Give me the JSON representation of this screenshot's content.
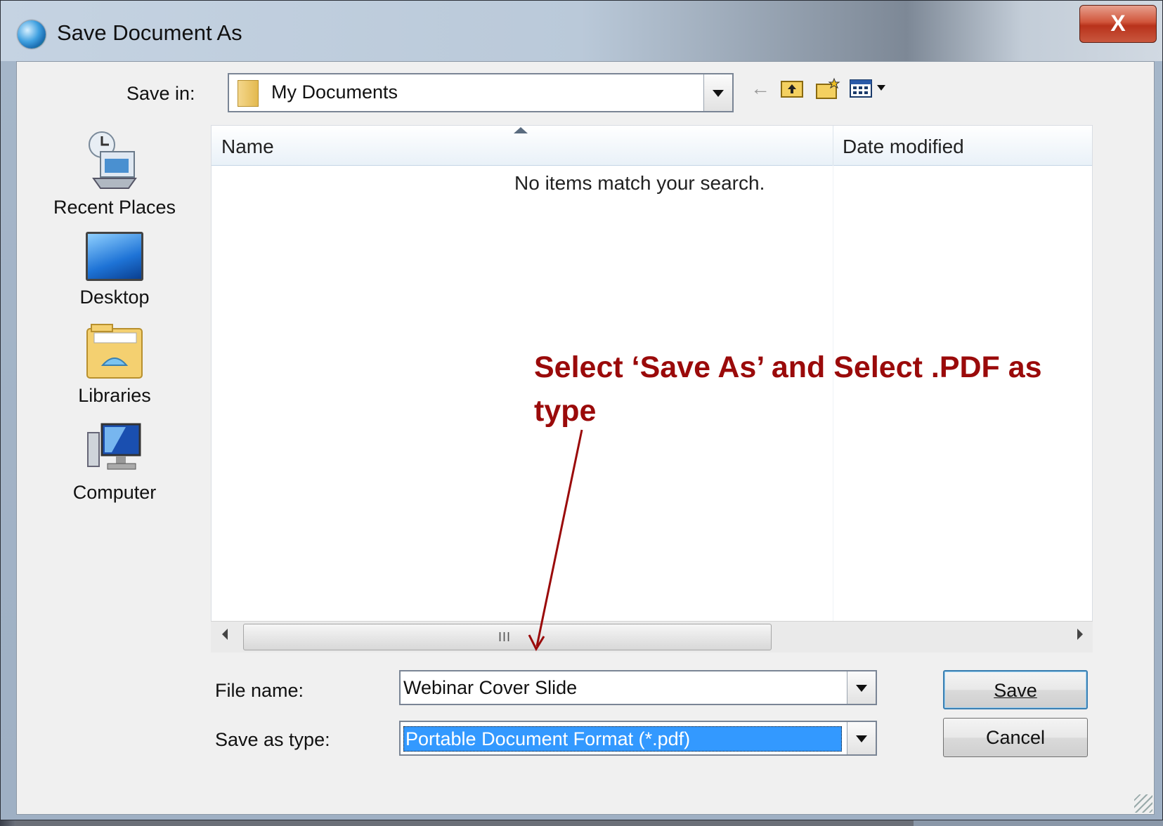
{
  "window": {
    "title": "Save Document As",
    "close_label": "X"
  },
  "save_in": {
    "label": "Save in:",
    "value": "My Documents"
  },
  "toolbar": {
    "back_icon": "back-arrow-icon",
    "up_icon": "up-folder-icon",
    "new_folder_icon": "new-folder-icon",
    "view_icon": "view-menu-icon"
  },
  "places": [
    {
      "label": "Recent Places",
      "icon": "recent-places-icon"
    },
    {
      "label": "Desktop",
      "icon": "desktop-icon"
    },
    {
      "label": "Libraries",
      "icon": "libraries-icon"
    },
    {
      "label": "Computer",
      "icon": "computer-icon"
    }
  ],
  "file_list": {
    "columns": [
      "Name",
      "Date modified"
    ],
    "empty_message": "No items match your search."
  },
  "scrollbar": {
    "grip": "III"
  },
  "file_name": {
    "label": "File name:",
    "value": "Webinar Cover Slide"
  },
  "save_as_type": {
    "label": "Save as type:",
    "value": "Portable Document Format (*.pdf)"
  },
  "buttons": {
    "save": "Save",
    "cancel": "Cancel"
  },
  "annotation": {
    "text": "Select ‘Save As’ and Select .PDF as type",
    "color": "#9a0a0a"
  }
}
